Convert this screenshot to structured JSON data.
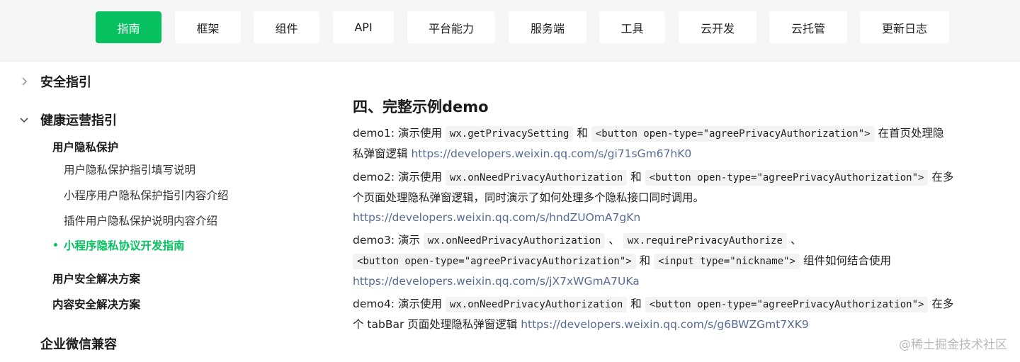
{
  "nav": {
    "tabs": [
      {
        "label": "指南",
        "active": true
      },
      {
        "label": "框架"
      },
      {
        "label": "组件"
      },
      {
        "label": "API"
      },
      {
        "label": "平台能力"
      },
      {
        "label": "服务端"
      },
      {
        "label": "工具"
      },
      {
        "label": "云开发"
      },
      {
        "label": "云托管"
      },
      {
        "label": "更新日志"
      }
    ]
  },
  "sidebar": {
    "security": "安全指引",
    "health": "健康运营指引",
    "privacy": "用户隐私保护",
    "leaves": [
      "用户隐私保护指引填写说明",
      "小程序用户隐私保护指引内容介绍",
      "插件用户隐私保护说明内容介绍",
      "小程序隐私协议开发指南"
    ],
    "user_security": "用户安全解决方案",
    "content_security": "内容安全解决方案",
    "wecom": "企业微信兼容"
  },
  "article": {
    "heading": "四、完整示例demo",
    "demo1": {
      "lead": "demo1: 演示使用",
      "code1": "wx.getPrivacySetting",
      "and": "和",
      "code2": "<button open-type=\"agreePrivacyAuthorization\">",
      "tail": "在首页处理隐私弹窗逻辑",
      "link": "https://developers.weixin.qq.com/s/gi71sGm67hK0"
    },
    "demo2": {
      "lead": "demo2: 演示使用",
      "code1": "wx.onNeedPrivacyAuthorization",
      "and": "和",
      "code2": "<button open-type=\"agreePrivacyAuthorization\">",
      "tail": "在多个页面处理隐私弹窗逻辑，同时演示了如何处理多个隐私接口同时调用。",
      "link": "https://developers.weixin.qq.com/s/hndZUOmA7gKn"
    },
    "demo3": {
      "lead": "demo3: 演示",
      "code1": "wx.onNeedPrivacyAuthorization",
      "sep1": "、",
      "code2": "wx.requirePrivacyAuthorize",
      "sep2": "、",
      "code3": "<button open-type=\"agreePrivacyAuthorization\">",
      "and": "和",
      "code4": "<input type=\"nickname\">",
      "tail": "组件如何结合使用",
      "link": "https://developers.weixin.qq.com/s/jX7xWGmA7UKa"
    },
    "demo4": {
      "lead": "demo4: 演示使用",
      "code1": "wx.onNeedPrivacyAuthorization",
      "and": "和",
      "code2": "<button open-type=\"agreePrivacyAuthorization\">",
      "tail": "在多个 tabBar 页面处理隐私弹窗逻辑",
      "link": "https://developers.weixin.qq.com/s/g6BWZGmt7XK9"
    }
  },
  "watermark": "@稀土掘金技术社区",
  "colors": {
    "accent": "#07c160",
    "link": "#576b95",
    "code_bg": "#f3f3f3",
    "nav_bg": "#f6f6f6"
  }
}
